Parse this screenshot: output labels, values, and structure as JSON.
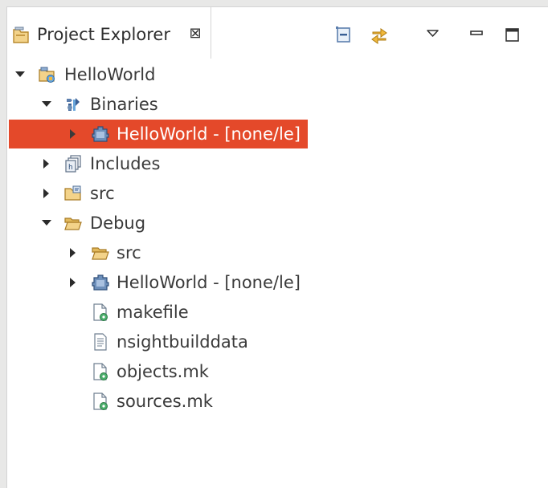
{
  "tab": {
    "title": "Project Explorer",
    "close_glyph": "⊠"
  },
  "toolbar": {
    "collapse_all": "collapse-all-icon",
    "link_with_editor": "link-with-editor-icon",
    "view_menu": "view-menu-icon",
    "minimize": "minimize-icon",
    "maximize": "maximize-icon"
  },
  "tree": [
    {
      "label": "HelloWorld",
      "icon": "cuda-project-icon",
      "expanded": true,
      "selected": false
    },
    {
      "label": "Binaries",
      "icon": "binaries-icon",
      "expanded": true,
      "selected": false
    },
    {
      "label": "HelloWorld - [none/le]",
      "icon": "executable-icon",
      "expanded": false,
      "selected": true
    },
    {
      "label": "Includes",
      "icon": "includes-icon",
      "expanded": false,
      "selected": false
    },
    {
      "label": "src",
      "icon": "source-folder-icon",
      "expanded": false,
      "selected": false
    },
    {
      "label": "Debug",
      "icon": "folder-open-icon",
      "expanded": true,
      "selected": false
    },
    {
      "label": "src",
      "icon": "folder-icon",
      "expanded": false,
      "selected": false
    },
    {
      "label": "HelloWorld - [none/le]",
      "icon": "executable-icon",
      "expanded": false,
      "selected": false
    },
    {
      "label": "makefile",
      "icon": "makefile-icon",
      "selected": false
    },
    {
      "label": "nsightbuilddata",
      "icon": "text-file-icon",
      "selected": false
    },
    {
      "label": "objects.mk",
      "icon": "makefile-icon",
      "selected": false
    },
    {
      "label": "sources.mk",
      "icon": "makefile-icon",
      "selected": false
    }
  ],
  "colors": {
    "selection": "#e4492a",
    "background": "#ffffff",
    "frame": "#e8e8e7"
  }
}
